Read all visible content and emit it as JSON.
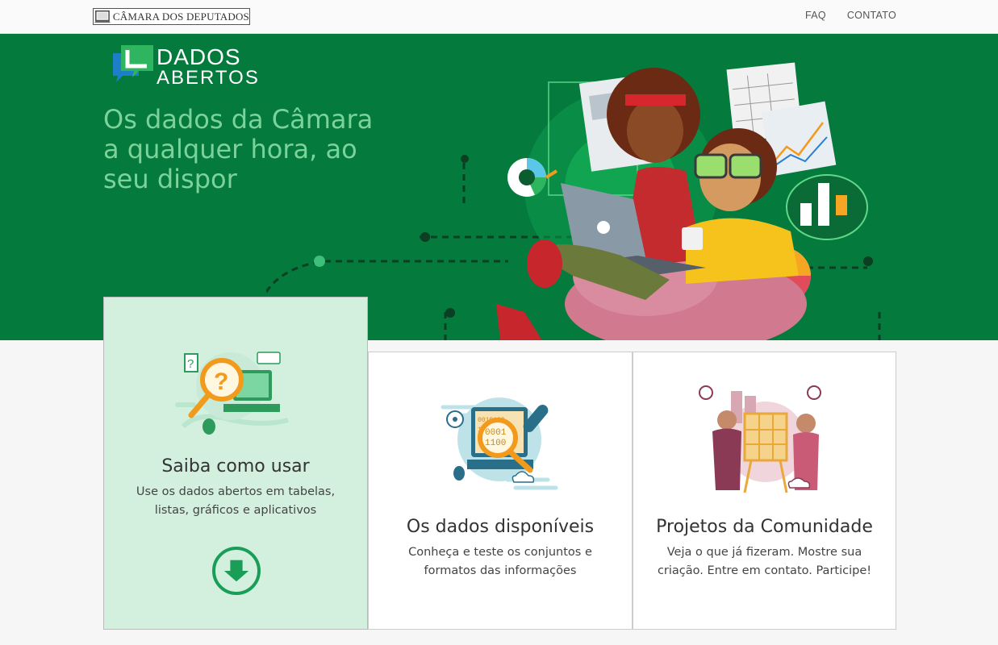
{
  "header": {
    "brand_text": "CÂMARA DOS DEPUTADOS",
    "nav": [
      {
        "label": "FAQ"
      },
      {
        "label": "CONTATO"
      }
    ]
  },
  "hero": {
    "logo_line1": "DADOS",
    "logo_line2": "ABERTOS",
    "headline": "Os dados da Câmara a qualquer hora, ao seu dispor"
  },
  "cards": [
    {
      "title": "Saiba como usar",
      "description_line1": "Use os dados abertos em tabelas,",
      "description_line2": "listas, gráficos e aplicativos",
      "icon": "magnifier-question-icon",
      "active": true
    },
    {
      "title": "Os dados disponíveis",
      "description_line1": "Conheça e teste os conjuntos e",
      "description_line2": "formatos das informações",
      "icon": "binary-data-icon",
      "active": false
    },
    {
      "title": "Projetos da Comunidade",
      "description_line1": "Veja o que já fizeram. Mostre sua",
      "description_line2": "criação. Entre em contato. Participe!",
      "icon": "community-projects-icon",
      "active": false
    }
  ],
  "colors": {
    "hero_green": "#047a3d",
    "headline_green": "#7cd39a",
    "accent_green": "#1a9e57",
    "active_card_bg": "#d3efde"
  }
}
